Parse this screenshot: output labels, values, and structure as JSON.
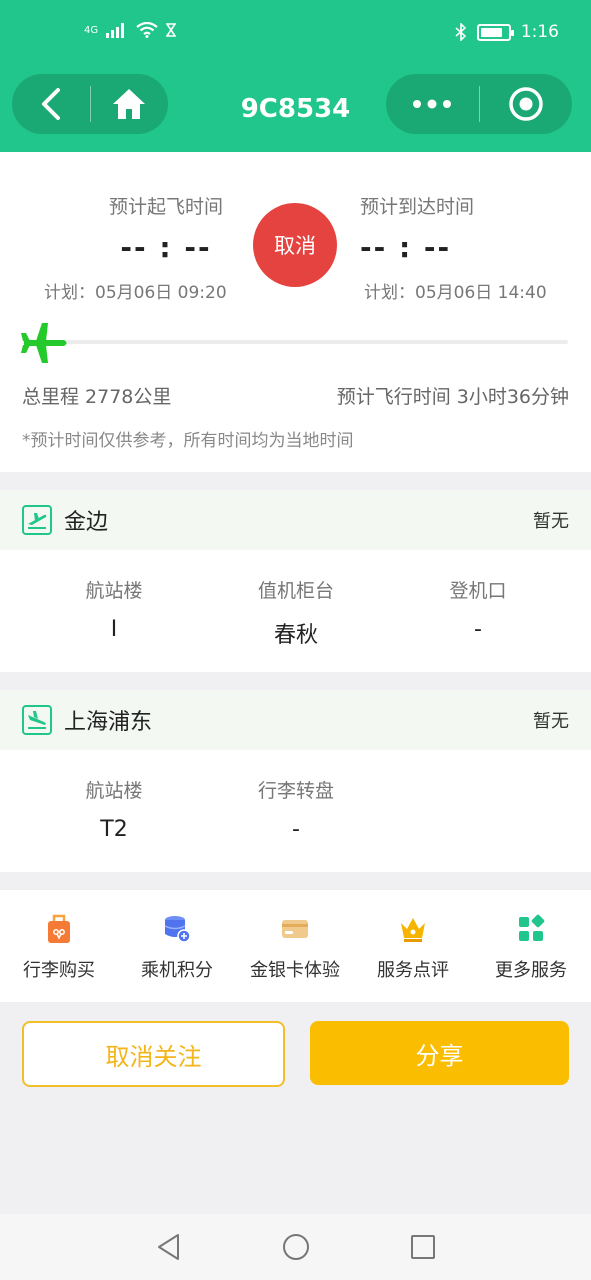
{
  "status_bar": {
    "network": "4G",
    "time": "1:16",
    "battery_level": 0.8
  },
  "header": {
    "title": "9C8534",
    "back_icon": "back-icon",
    "home_icon": "home-icon",
    "more_icon": "more-dots-icon",
    "target_icon": "target-icon",
    "background": "#21c68c"
  },
  "flight": {
    "depart_label": "预计起飞时间",
    "depart_time": "-- : --",
    "depart_plan": "计划：05月06日 09:20",
    "arrive_label": "预计到达时间",
    "arrive_time": "-- : --",
    "arrive_plan": "计划：05月06日 14:40",
    "status_badge": "取消",
    "distance": "总里程 2778公里",
    "duration": "预计飞行时间 3小时36分钟",
    "note": "*预计时间仅供参考，所有时间均为当地时间",
    "progress": 0
  },
  "departure": {
    "name": "金边",
    "status": "暂无",
    "fields": [
      {
        "key": "航站楼",
        "value": "I"
      },
      {
        "key": "值机柜台",
        "value": "春秋"
      },
      {
        "key": "登机口",
        "value": "-"
      }
    ]
  },
  "arrival": {
    "name": "上海浦东",
    "status": "暂无",
    "fields": [
      {
        "key": "航站楼",
        "value": "T2"
      },
      {
        "key": "行李转盘",
        "value": "-"
      }
    ]
  },
  "services": [
    {
      "label": "行李购买",
      "icon": "luggage-icon"
    },
    {
      "label": "乘机积分",
      "icon": "points-icon"
    },
    {
      "label": "金银卡体验",
      "icon": "card-icon"
    },
    {
      "label": "服务点评",
      "icon": "crown-icon"
    },
    {
      "label": "更多服务",
      "icon": "grid-icon"
    }
  ],
  "actions": {
    "unfollow": "取消关注",
    "share": "分享"
  }
}
